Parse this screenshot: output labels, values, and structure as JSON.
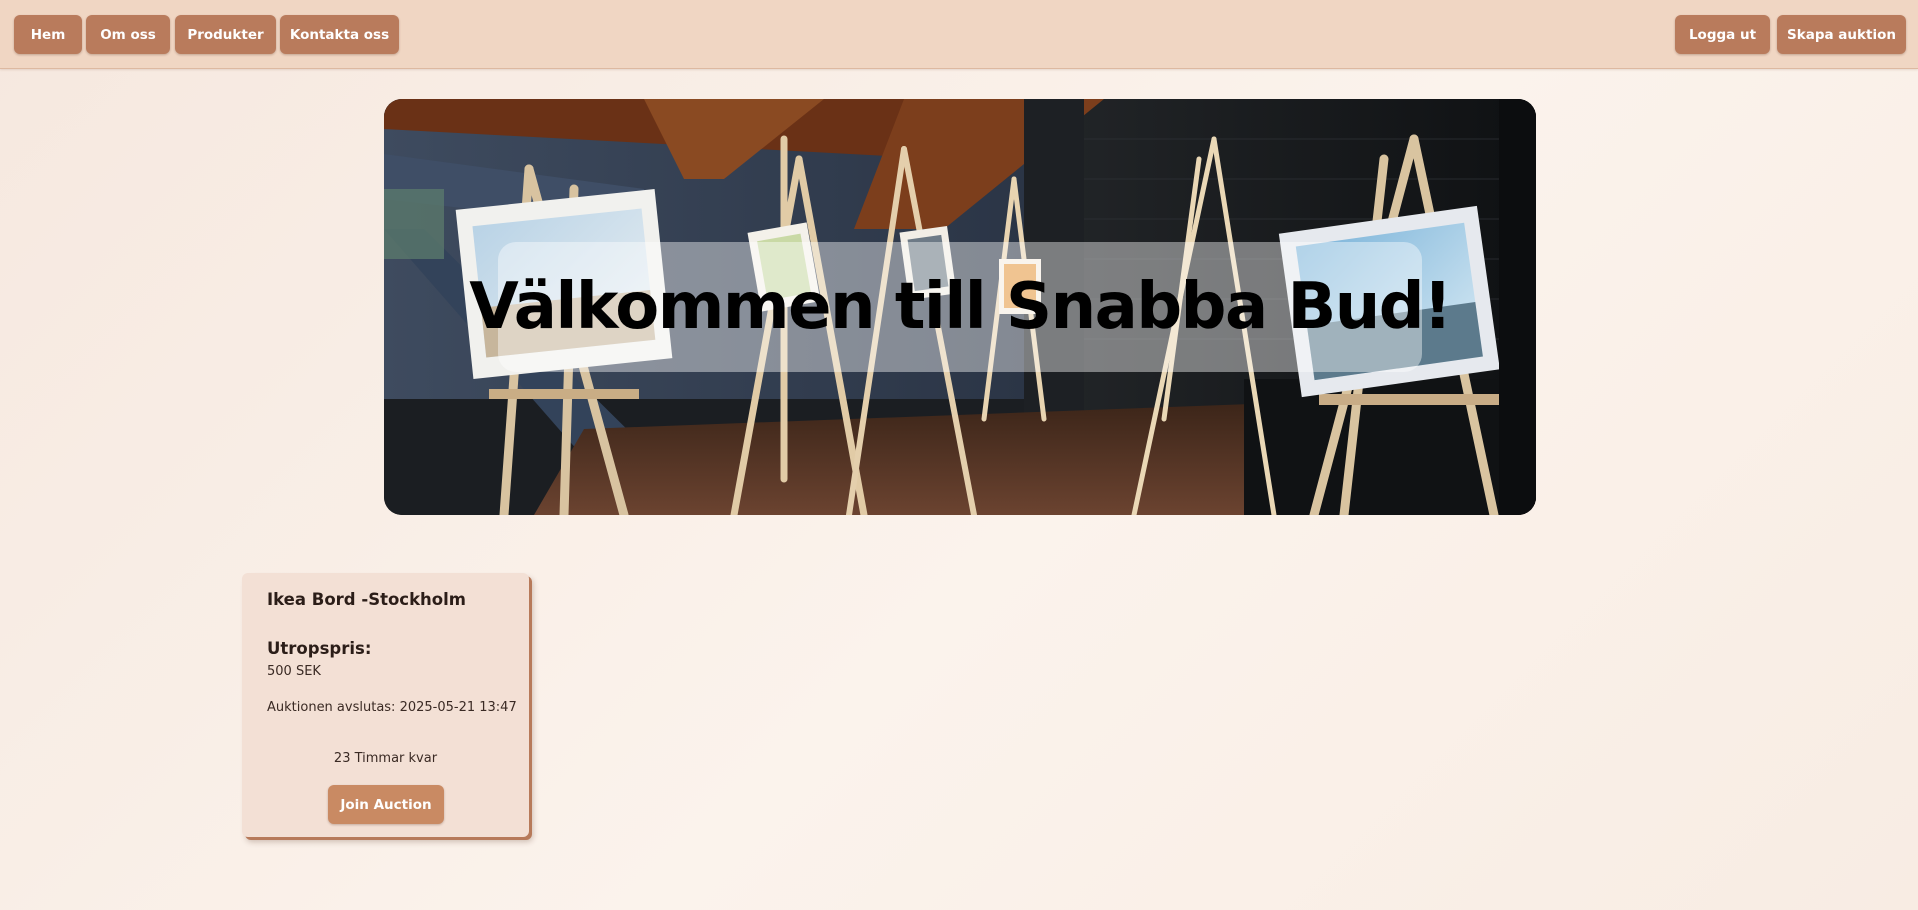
{
  "nav": {
    "left": [
      {
        "id": "nav-home",
        "label": "Hem"
      },
      {
        "id": "nav-about",
        "label": "Om oss"
      },
      {
        "id": "nav-products",
        "label": "Produkter"
      },
      {
        "id": "nav-contact",
        "label": "Kontakta oss"
      }
    ],
    "right": [
      {
        "id": "nav-logout",
        "label": "Logga ut"
      },
      {
        "id": "nav-create",
        "label": "Skapa auktion"
      }
    ]
  },
  "hero": {
    "title": "Välkommen till Snabba Bud!"
  },
  "auctions": [
    {
      "title": "Ikea Bord -Stockholm",
      "price_label": "Utropspris:",
      "price": "500 SEK",
      "ends": "Auktionen avslutas: 2025-05-21 13:47",
      "countdown": "23 Timmar kvar",
      "button": "Join Auction"
    }
  ],
  "colors": {
    "navbar_bg": "#f0d6c3",
    "nav_button": "#b97b5c",
    "card_bg": "#f3e0d5",
    "card_button": "#c98a63",
    "page_bg": "#fbf3ec"
  }
}
